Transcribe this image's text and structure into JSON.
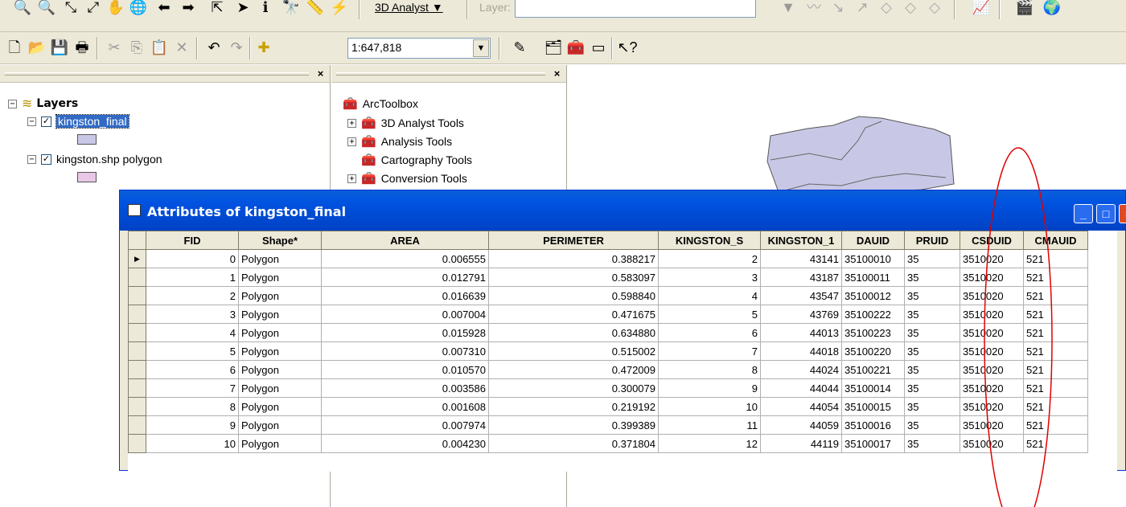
{
  "toolbar1": {
    "analyst_label": "3D Analyst ▼",
    "layer_label": "Layer:"
  },
  "toolbar2": {
    "scale_value": "1:647,818"
  },
  "toc": {
    "root_label": "Layers",
    "layers": [
      {
        "label": "kingston_final",
        "checked": true,
        "swatch_color": "#c8c8e6"
      },
      {
        "label": "kingston.shp polygon",
        "checked": true,
        "swatch_color": "#e8c8e6"
      }
    ]
  },
  "toolbox": {
    "root_label": "ArcToolbox",
    "items": [
      {
        "label": "3D Analyst Tools"
      },
      {
        "label": "Analysis Tools"
      },
      {
        "label": "Cartography Tools"
      },
      {
        "label": "Conversion Tools"
      }
    ]
  },
  "map": {
    "polygon_fill": "#c8c8e6"
  },
  "attributes": {
    "title": "Attributes of kingston_final",
    "columns": [
      "FID",
      "Shape*",
      "AREA",
      "PERIMETER",
      "KINGSTON_S",
      "KINGSTON_1",
      "DAUID",
      "PRUID",
      "CSDUID",
      "CMAUID"
    ],
    "rows": [
      [
        "0",
        "Polygon",
        "0.006555",
        "0.388217",
        "2",
        "43141",
        "35100010",
        "35",
        "3510020",
        "521"
      ],
      [
        "1",
        "Polygon",
        "0.012791",
        "0.583097",
        "3",
        "43187",
        "35100011",
        "35",
        "3510020",
        "521"
      ],
      [
        "2",
        "Polygon",
        "0.016639",
        "0.598840",
        "4",
        "43547",
        "35100012",
        "35",
        "3510020",
        "521"
      ],
      [
        "3",
        "Polygon",
        "0.007004",
        "0.471675",
        "5",
        "43769",
        "35100222",
        "35",
        "3510020",
        "521"
      ],
      [
        "4",
        "Polygon",
        "0.015928",
        "0.634880",
        "6",
        "44013",
        "35100223",
        "35",
        "3510020",
        "521"
      ],
      [
        "5",
        "Polygon",
        "0.007310",
        "0.515002",
        "7",
        "44018",
        "35100220",
        "35",
        "3510020",
        "521"
      ],
      [
        "6",
        "Polygon",
        "0.010570",
        "0.472009",
        "8",
        "44024",
        "35100221",
        "35",
        "3510020",
        "521"
      ],
      [
        "7",
        "Polygon",
        "0.003586",
        "0.300079",
        "9",
        "44044",
        "35100014",
        "35",
        "3510020",
        "521"
      ],
      [
        "8",
        "Polygon",
        "0.001608",
        "0.219192",
        "10",
        "44054",
        "35100015",
        "35",
        "3510020",
        "521"
      ],
      [
        "9",
        "Polygon",
        "0.007974",
        "0.399389",
        "11",
        "44059",
        "35100016",
        "35",
        "3510020",
        "521"
      ],
      [
        "10",
        "Polygon",
        "0.004230",
        "0.371804",
        "12",
        "44119",
        "35100017",
        "35",
        "3510020",
        "521"
      ]
    ]
  },
  "annotation": {
    "oval_color": "#e00000"
  }
}
